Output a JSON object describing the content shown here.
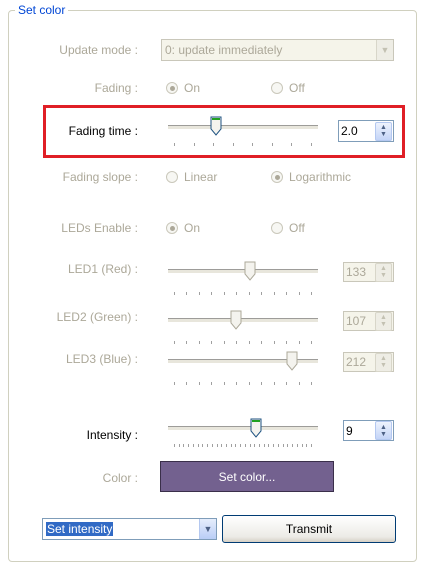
{
  "group": {
    "title": "Set color"
  },
  "update_mode": {
    "label": "Update mode :",
    "value": "0: update immediately"
  },
  "fading": {
    "label": "Fading :",
    "on": "On",
    "off": "Off",
    "selected": "On"
  },
  "fading_time": {
    "label": "Fading time :",
    "value": "2.0",
    "slider_fraction": 0.33
  },
  "fading_slope": {
    "label": "Fading slope :",
    "linear": "Linear",
    "logarithmic": "Logarithmic",
    "selected": "Logarithmic"
  },
  "leds_enable": {
    "label": "LEDs Enable :",
    "on": "On",
    "off": "Off",
    "selected": "On"
  },
  "leds": [
    {
      "label": "LED1 (Red) :",
      "value": "133",
      "slider_fraction": 0.52
    },
    {
      "label": "LED2 (Green) :",
      "value": "107",
      "slider_fraction": 0.42
    },
    {
      "label": "LED3 (Blue) :",
      "value": "212",
      "slider_fraction": 0.83
    }
  ],
  "intensity": {
    "label": "Intensity :",
    "value": "9",
    "slider_fraction": 0.6
  },
  "color": {
    "label": "Color :",
    "button_label": "Set color...",
    "swatch": "#73618f"
  },
  "action": {
    "value": "Set intensity"
  },
  "transmit": {
    "label": "Transmit"
  },
  "colors": {
    "highlight": "#e01f26",
    "group_title": "#0046d5",
    "disabled_text": "#aca899",
    "radio_dot": "#21a121"
  }
}
